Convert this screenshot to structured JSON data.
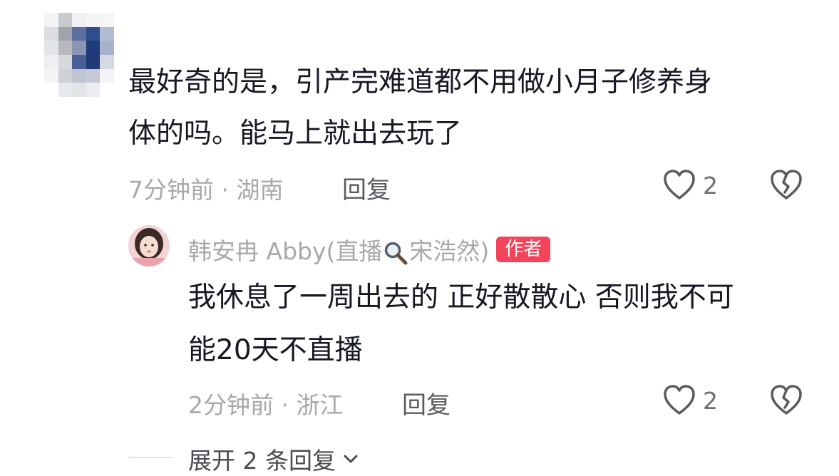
{
  "comment": {
    "text_line1": "最好奇的是，引产完难道都不用做小月子修养身",
    "text_line2": "体的吗。能马上就出去玩了",
    "time": "7分钟前",
    "location": "湖南",
    "separator": "·",
    "reply_label": "回复",
    "likes": "2"
  },
  "reply": {
    "username_prefix": "韩安冉 Abby(直播",
    "username_suffix": "宋浩然)",
    "author_badge": "作者",
    "text_line1": "我休息了一周出去的 正好散散心 否则我不可",
    "text_line2": "能20天不直播",
    "time": "2分钟前",
    "location": "浙江",
    "separator": "·",
    "reply_label": "回复",
    "likes": "2"
  },
  "expand_replies": {
    "label": "展开 2 条回复"
  },
  "icons": {
    "like": "heart-outline-icon",
    "dislike": "broken-heart-icon",
    "search": "magnifier-icon",
    "expand": "chevron-down-icon"
  },
  "colors": {
    "text": "#161823",
    "meta": "#a8a8ad",
    "badge": "#f2455b"
  }
}
